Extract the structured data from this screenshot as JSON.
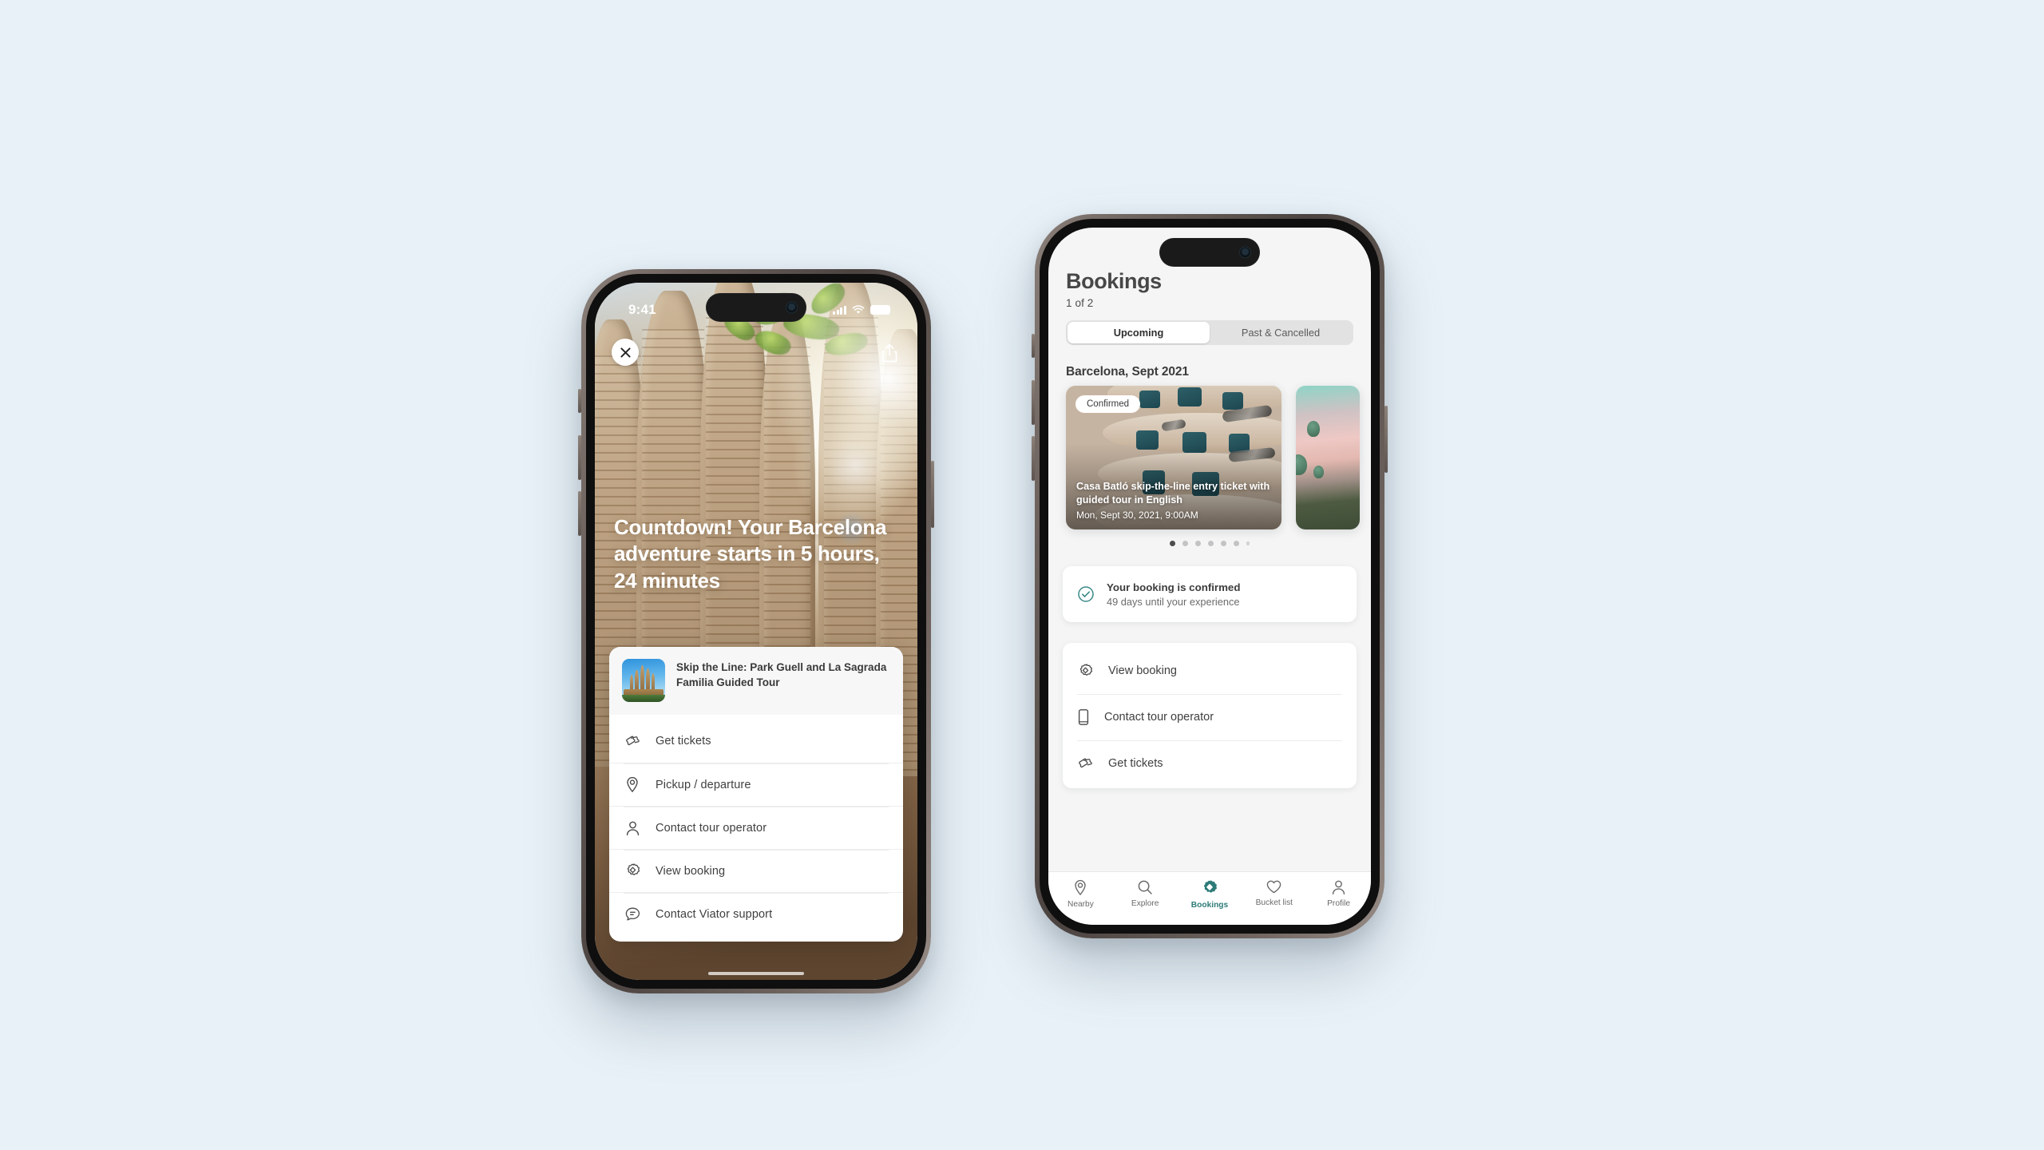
{
  "background_color": "#e8f1f7",
  "accent_color": "#2d7b78",
  "left_phone": {
    "status_bar": {
      "time": "9:41",
      "icons": [
        "cellular-signal",
        "wifi",
        "battery"
      ]
    },
    "close_button_label": "×",
    "share_icon": "share-icon",
    "hero_title": "Countdown! Your Barcelona adventure starts in 5 hours, 24 minutes",
    "sheet": {
      "product_title": "Skip the Line: Park Guell and La Sagrada Familia Guided Tour",
      "thumbnail_alt": "sagrada-familia-thumbnail",
      "menu_items": [
        {
          "icon": "ticket-icon",
          "label": "Get tickets"
        },
        {
          "icon": "map-pin-icon",
          "label": "Pickup / departure"
        },
        {
          "icon": "person-icon",
          "label": "Contact tour operator"
        },
        {
          "icon": "tag-badge-icon",
          "label": "View booking"
        },
        {
          "icon": "chat-bubble-icon",
          "label": "Contact Viator support"
        }
      ]
    }
  },
  "right_phone": {
    "header": {
      "title": "Bookings",
      "count": "1 of 2"
    },
    "segmented_control": {
      "options": [
        "Upcoming",
        "Past & Cancelled"
      ],
      "selected": "Upcoming"
    },
    "section_title": "Barcelona, Sept 2021",
    "booking_card": {
      "status_chip": "Confirmed",
      "name": "Casa Batló skip-the-line entry ticket with guided tour in English",
      "date": "Mon, Sept 30, 2021, 9:00AM",
      "image_alt": "casa-mila-facade"
    },
    "second_card_image_alt": "hot-air-balloons",
    "carousel": {
      "total_dots": 7,
      "active_index": 0
    },
    "confirmation": {
      "icon": "check-circle-icon",
      "title": "Your booking is confirmed",
      "subtitle": "49 days until your experience"
    },
    "actions": [
      {
        "icon": "tag-badge-icon",
        "label": "View booking"
      },
      {
        "icon": "phone-icon",
        "label": "Contact tour operator"
      },
      {
        "icon": "ticket-icon",
        "label": "Get tickets"
      }
    ],
    "tab_bar": {
      "active": "Bookings",
      "tabs": [
        {
          "icon": "map-pin-icon",
          "label": "Nearby"
        },
        {
          "icon": "search-icon",
          "label": "Explore"
        },
        {
          "icon": "tag-badge-icon",
          "label": "Bookings"
        },
        {
          "icon": "heart-icon",
          "label": "Bucket list"
        },
        {
          "icon": "person-icon",
          "label": "Profile"
        }
      ]
    }
  }
}
